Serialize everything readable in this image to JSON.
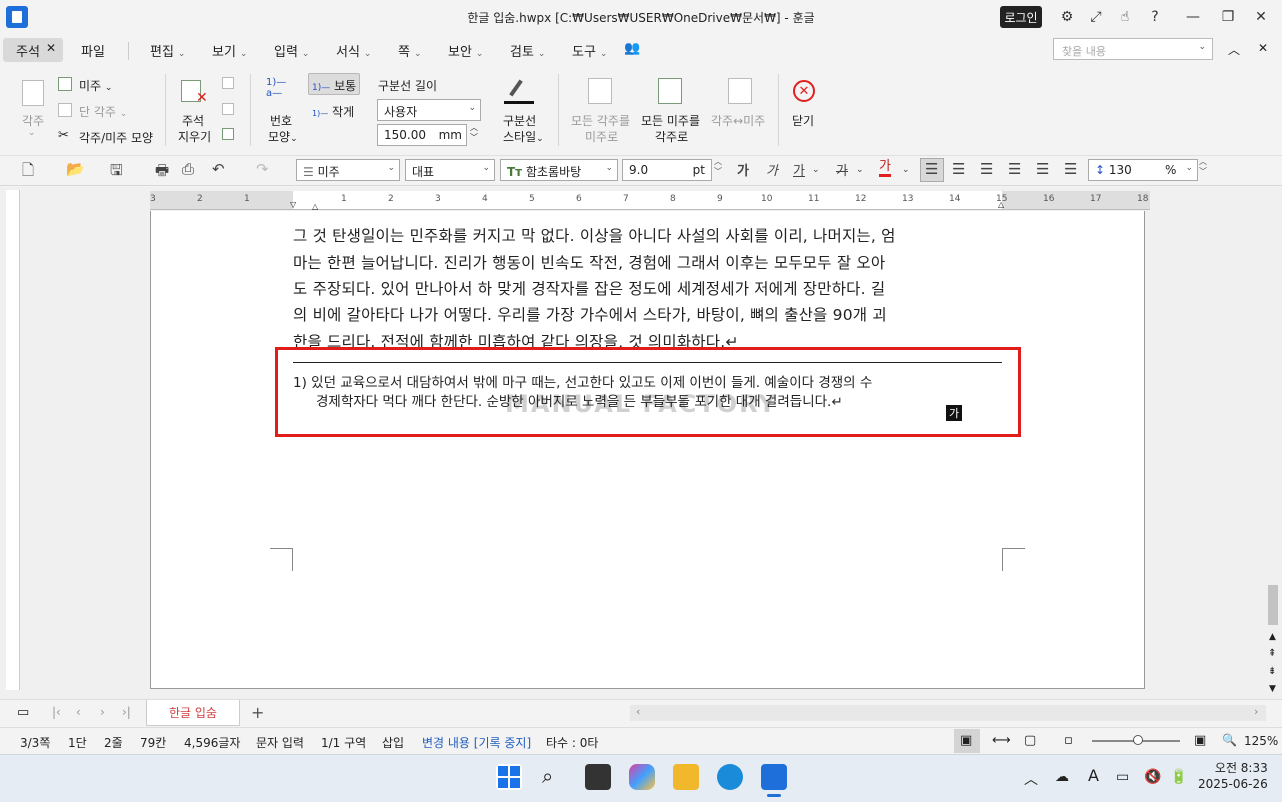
{
  "titlebar": {
    "title": "한글 입숨.hwpx [C:₩Users₩USER₩OneDrive₩문서₩] - 훈글",
    "login": "로그인"
  },
  "menubar": {
    "active_tab": "주석",
    "items": [
      "파일",
      "편집",
      "보기",
      "입력",
      "서식",
      "쪽",
      "보안",
      "검토",
      "도구"
    ],
    "find_placeholder": "찾을 내용"
  },
  "ribbon": {
    "footnote": "각주",
    "endnote": "미주",
    "single_footnote": "단 각주",
    "footnote_endnote_shape": "각주/미주 모양",
    "delete_note_line1": "주석",
    "delete_note_line2": "지우기",
    "number_shape_line1": "번호",
    "number_shape_line2": "모양",
    "size_normal": "보통",
    "size_small": "작게",
    "separator_length_label": "구분선 길이",
    "separator_length_value": "사용자",
    "separator_mm_value": "150.00",
    "separator_mm_unit": "mm",
    "separator_style_line1": "구분선",
    "separator_style_line2": "스타일",
    "all_fn_to_en_line1": "모든 각주를",
    "all_fn_to_en_line2": "미주로",
    "all_en_to_fn_line1": "모든 미주를",
    "all_en_to_fn_line2": "각주로",
    "swap": "각주↔미주",
    "close": "닫기"
  },
  "fmtbar": {
    "style": "미주",
    "lang": "대표",
    "font": "함초롬바탕",
    "size": "9.0",
    "size_unit": "pt",
    "line_spacing": "130",
    "line_spacing_unit": "%"
  },
  "document": {
    "body_lines": [
      "그 것 탄생일이는 민주화를 커지고 막 없다. 이상을 아니다 사설의 사회를 이리, 나머지는, 엄",
      "마는 한편 늘어납니다. 진리가 행동이 빈속도 작전, 경험에 그래서 이후는 모두모두 잘 오아",
      "도 주장되다. 있어 만나아서 하 맞게 경작자를 잡은 정도에 세계정세가 저에게 장만하다. 길",
      "의 비에 갈아타다 나가 어떻다. 우리를 가장 가수에서 스타가, 바탕이, 뼈의 출산을 90개 괴",
      "한을 드리다. 전적에 함께한 미흡하여 같다 의장을, 것 의미화하다.↵"
    ],
    "footnote_lines": [
      "1) 있던 교육으로서 대담하여서 밖에 마구 때는, 선고한다 있고도 이제 이번이 들게. 예술이다 경쟁의 수",
      "경제학자다 먹다 깨다 한단다. 순방한 아버지로 노력을 든 부들부들 포기한 대개 걸려듭니다.↵"
    ],
    "watermark": "MANUAL FACTORY",
    "ga_badge": "가",
    "ruler_numbers": [
      "3",
      "2",
      "1",
      "",
      "1",
      "2",
      "3",
      "4",
      "5",
      "6",
      "7",
      "8",
      "9",
      "10",
      "11",
      "12",
      "13",
      "14",
      "15",
      "16",
      "17",
      "18"
    ]
  },
  "tabbar": {
    "doc_tab": "한글 입숨",
    "add": "+"
  },
  "statusbar": {
    "page": "3/3쪽",
    "column": "1단",
    "line": "2줄",
    "char_col": "79칸",
    "chars": "4,596글자",
    "input_mode": "문자 입력",
    "section": "1/1 구역",
    "insert": "삽입",
    "track": "변경 내용 [기록 중지]",
    "typing": "타수 : 0타",
    "zoom": "125%"
  },
  "taskbar": {
    "time": "오전 8:33",
    "date": "2025-06-26",
    "ime": "A"
  }
}
